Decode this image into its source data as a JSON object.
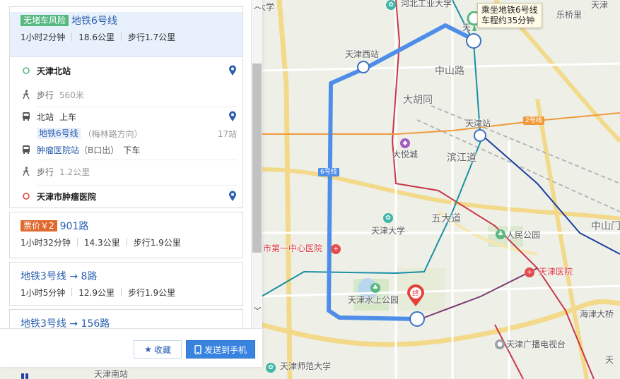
{
  "map": {
    "labels": {
      "hebei_univ_tech": "河北工业大学",
      "commerce_univ": "商业大学",
      "lequanqiao": "乐桥里",
      "tianjin_west": "天津西站",
      "zhongshan_road": "中山路",
      "dahutong": "大胡同",
      "tianjin_station": "天津站",
      "line2": "2号线",
      "line6": "6号线",
      "joy_city": "大悦城",
      "binjiang": "滨江道",
      "wudadao": "五大道",
      "tianjin_univ": "天津大学",
      "peoples_park": "人民公园",
      "zhongshan_men": "中山门",
      "first_hospital": "市第一中心医院",
      "tianjin_hospital": "天津医院",
      "water_park": "天津水上公园",
      "haihe_bridge": "海津大桥",
      "broadcast_tower": "天津广播电视台",
      "normal_univ": "天津师范大学",
      "tianjin_south": "天津南站",
      "tianjin_edge": "天",
      "tianjin_top": "天",
      "tianjin_right": "天津"
    },
    "tooltip_line1": "乘坐地铁6号线",
    "tooltip_line2": "车程约35分钟",
    "end_marker": "终"
  },
  "routes": {
    "route1": {
      "tag": "无堵车风险",
      "name": "地铁6号线",
      "duration": "1小时2分钟",
      "distance": "18.6公里",
      "walk": "步行1.7公里",
      "steps": {
        "start": "天津北站",
        "walk1_label": "步行",
        "walk1_dist": "560米",
        "board_station": "北站",
        "board_action": "上车",
        "line": "地铁6号线",
        "direction": "（梅林路方向）",
        "stops": "17站",
        "alight_station": "肿瘤医院站",
        "alight_exit": "（B口出）",
        "alight_action": "下车",
        "walk2_label": "步行",
        "walk2_dist": "1.2公里",
        "end": "天津市肿瘤医院"
      }
    },
    "route2": {
      "tag": "票价￥2",
      "name": "901路",
      "duration": "1小时32分钟",
      "distance": "14.3公里",
      "walk": "步行1.9公里"
    },
    "route3": {
      "name": "地铁3号线 → 8路",
      "duration": "1小时5分钟",
      "distance": "12.9公里",
      "walk": "步行1.9公里"
    },
    "route4": {
      "name": "地铁3号线 → 156路"
    }
  },
  "actions": {
    "favorite": "收藏",
    "send_to_phone": "发送到手机"
  },
  "icons": [
    "location-pin-icon",
    "walk-icon",
    "bus-icon",
    "star-icon",
    "phone-icon",
    "scroll-up-icon",
    "scroll-down-icon",
    "subway-icon"
  ],
  "colors": {
    "route_line": "#4f8ee8",
    "link_blue": "#2a5fb0",
    "tag_green": "#58b980",
    "tag_orange": "#e0692e",
    "button_blue": "#3983e0"
  }
}
